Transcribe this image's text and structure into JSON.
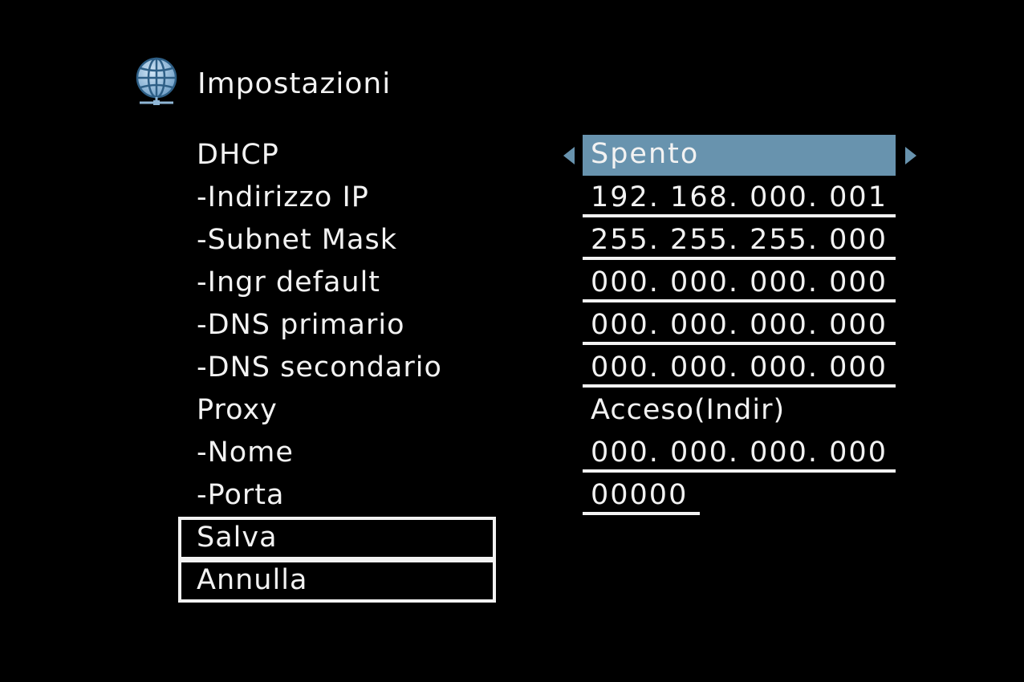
{
  "header": {
    "title": "Impostazioni",
    "icon": "globe-network-icon"
  },
  "settings": [
    {
      "label": "DHCP",
      "value": "Spento"
    },
    {
      "label": "-Indirizzo IP",
      "value": "192. 168. 000. 001"
    },
    {
      "label": "-Subnet Mask",
      "value": "255. 255. 255. 000"
    },
    {
      "label": "-Ingr default",
      "value": "000. 000. 000. 000"
    },
    {
      "label": "-DNS primario",
      "value": "000. 000. 000. 000"
    },
    {
      "label": "-DNS secondario",
      "value": "000. 000. 000. 000"
    },
    {
      "label": "Proxy",
      "value": "Acceso(Indir)"
    },
    {
      "label": "-Nome",
      "value": "000. 000. 000. 000"
    },
    {
      "label": "-Porta",
      "value": "00000"
    }
  ],
  "buttons": {
    "save": "Salva",
    "cancel": "Annulla"
  },
  "colors": {
    "background": "#000000",
    "text": "#f2f2f2",
    "selection": "#6893ae"
  }
}
